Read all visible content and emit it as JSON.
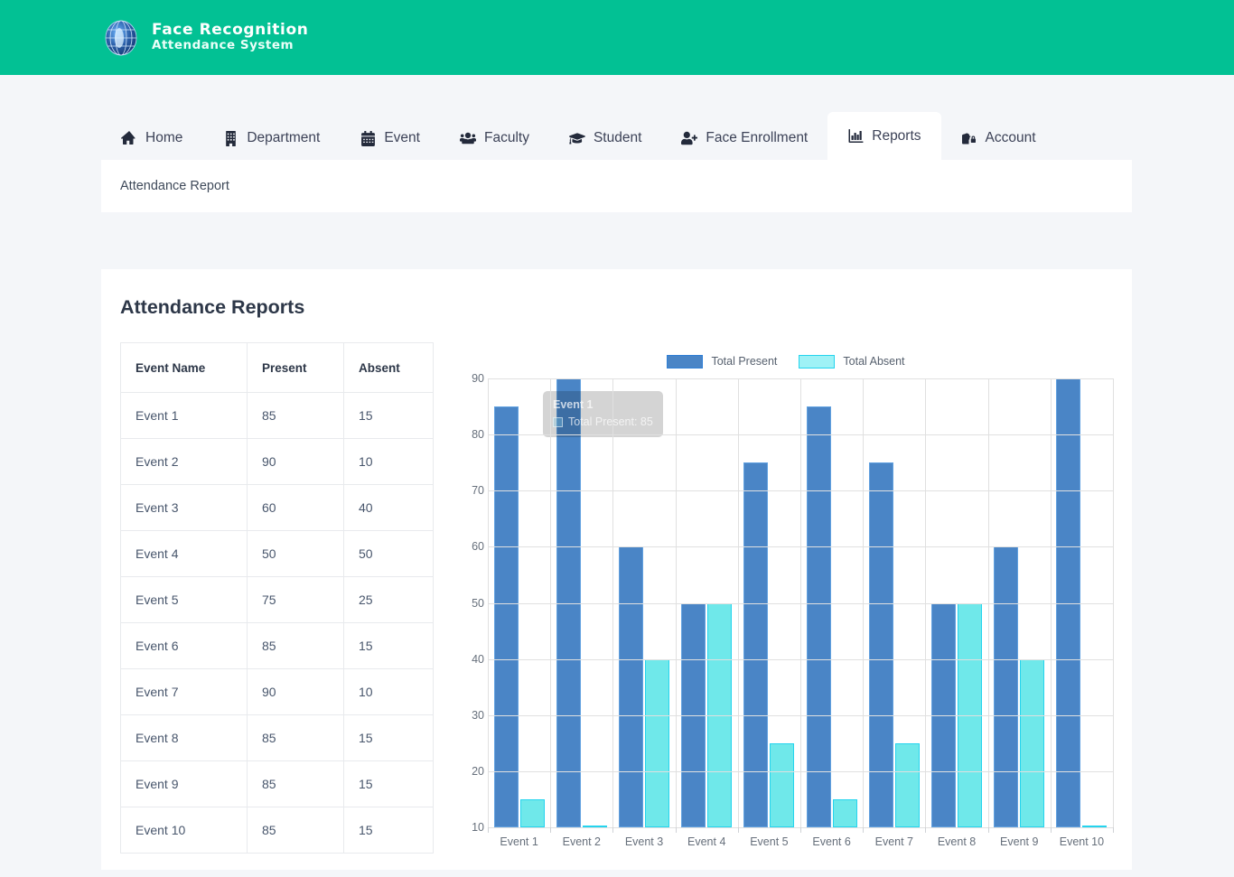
{
  "header": {
    "brand_line1": "Face Recognition",
    "brand_line2": "Attendance System",
    "brand_icon": "globe-icon",
    "bg_color": "#02c194"
  },
  "nav": {
    "tabs": [
      {
        "label": "Home",
        "icon": "home-icon",
        "active": false
      },
      {
        "label": "Department",
        "icon": "building-icon",
        "active": false
      },
      {
        "label": "Event",
        "icon": "calendar-icon",
        "active": false
      },
      {
        "label": "Faculty",
        "icon": "users-icon",
        "active": false
      },
      {
        "label": "Student",
        "icon": "graduation-icon",
        "active": false
      },
      {
        "label": "Face Enrollment",
        "icon": "user-plus-icon",
        "active": false
      },
      {
        "label": "Reports",
        "icon": "bar-chart-icon",
        "active": true
      },
      {
        "label": "Account",
        "icon": "user-lock-icon",
        "active": false
      }
    ]
  },
  "breadcrumb": {
    "text": "Attendance Report"
  },
  "main": {
    "title": "Attendance Reports",
    "table": {
      "columns": [
        "Event Name",
        "Present",
        "Absent"
      ],
      "rows": [
        [
          "Event 1",
          "85",
          "15"
        ],
        [
          "Event 2",
          "90",
          "10"
        ],
        [
          "Event 3",
          "60",
          "40"
        ],
        [
          "Event 4",
          "50",
          "50"
        ],
        [
          "Event 5",
          "75",
          "25"
        ],
        [
          "Event 6",
          "85",
          "15"
        ],
        [
          "Event 7",
          "90",
          "10"
        ],
        [
          "Event 8",
          "85",
          "15"
        ],
        [
          "Event 9",
          "85",
          "15"
        ],
        [
          "Event 10",
          "85",
          "15"
        ]
      ]
    },
    "tooltip": {
      "title": "Event 1",
      "row": "Total Present: 85"
    }
  },
  "chart_data": {
    "type": "bar",
    "title": "",
    "xlabel": "",
    "ylabel": "",
    "categories": [
      "Event 1",
      "Event 2",
      "Event 3",
      "Event 4",
      "Event 5",
      "Event 6",
      "Event 7",
      "Event 8",
      "Event 9",
      "Event 10"
    ],
    "series": [
      {
        "name": "Total Present",
        "color": "#4a85c6",
        "values": [
          85,
          90,
          60,
          50,
          75,
          85,
          75,
          50,
          60,
          90
        ]
      },
      {
        "name": "Total Absent",
        "color": "#6fe8ea",
        "values": [
          15,
          10,
          40,
          50,
          25,
          15,
          25,
          50,
          40,
          10
        ]
      }
    ],
    "ylim": [
      10,
      90
    ],
    "yticks": [
      10,
      20,
      30,
      40,
      50,
      60,
      70,
      80,
      90
    ],
    "grid": true,
    "legend_position": "top-center"
  }
}
